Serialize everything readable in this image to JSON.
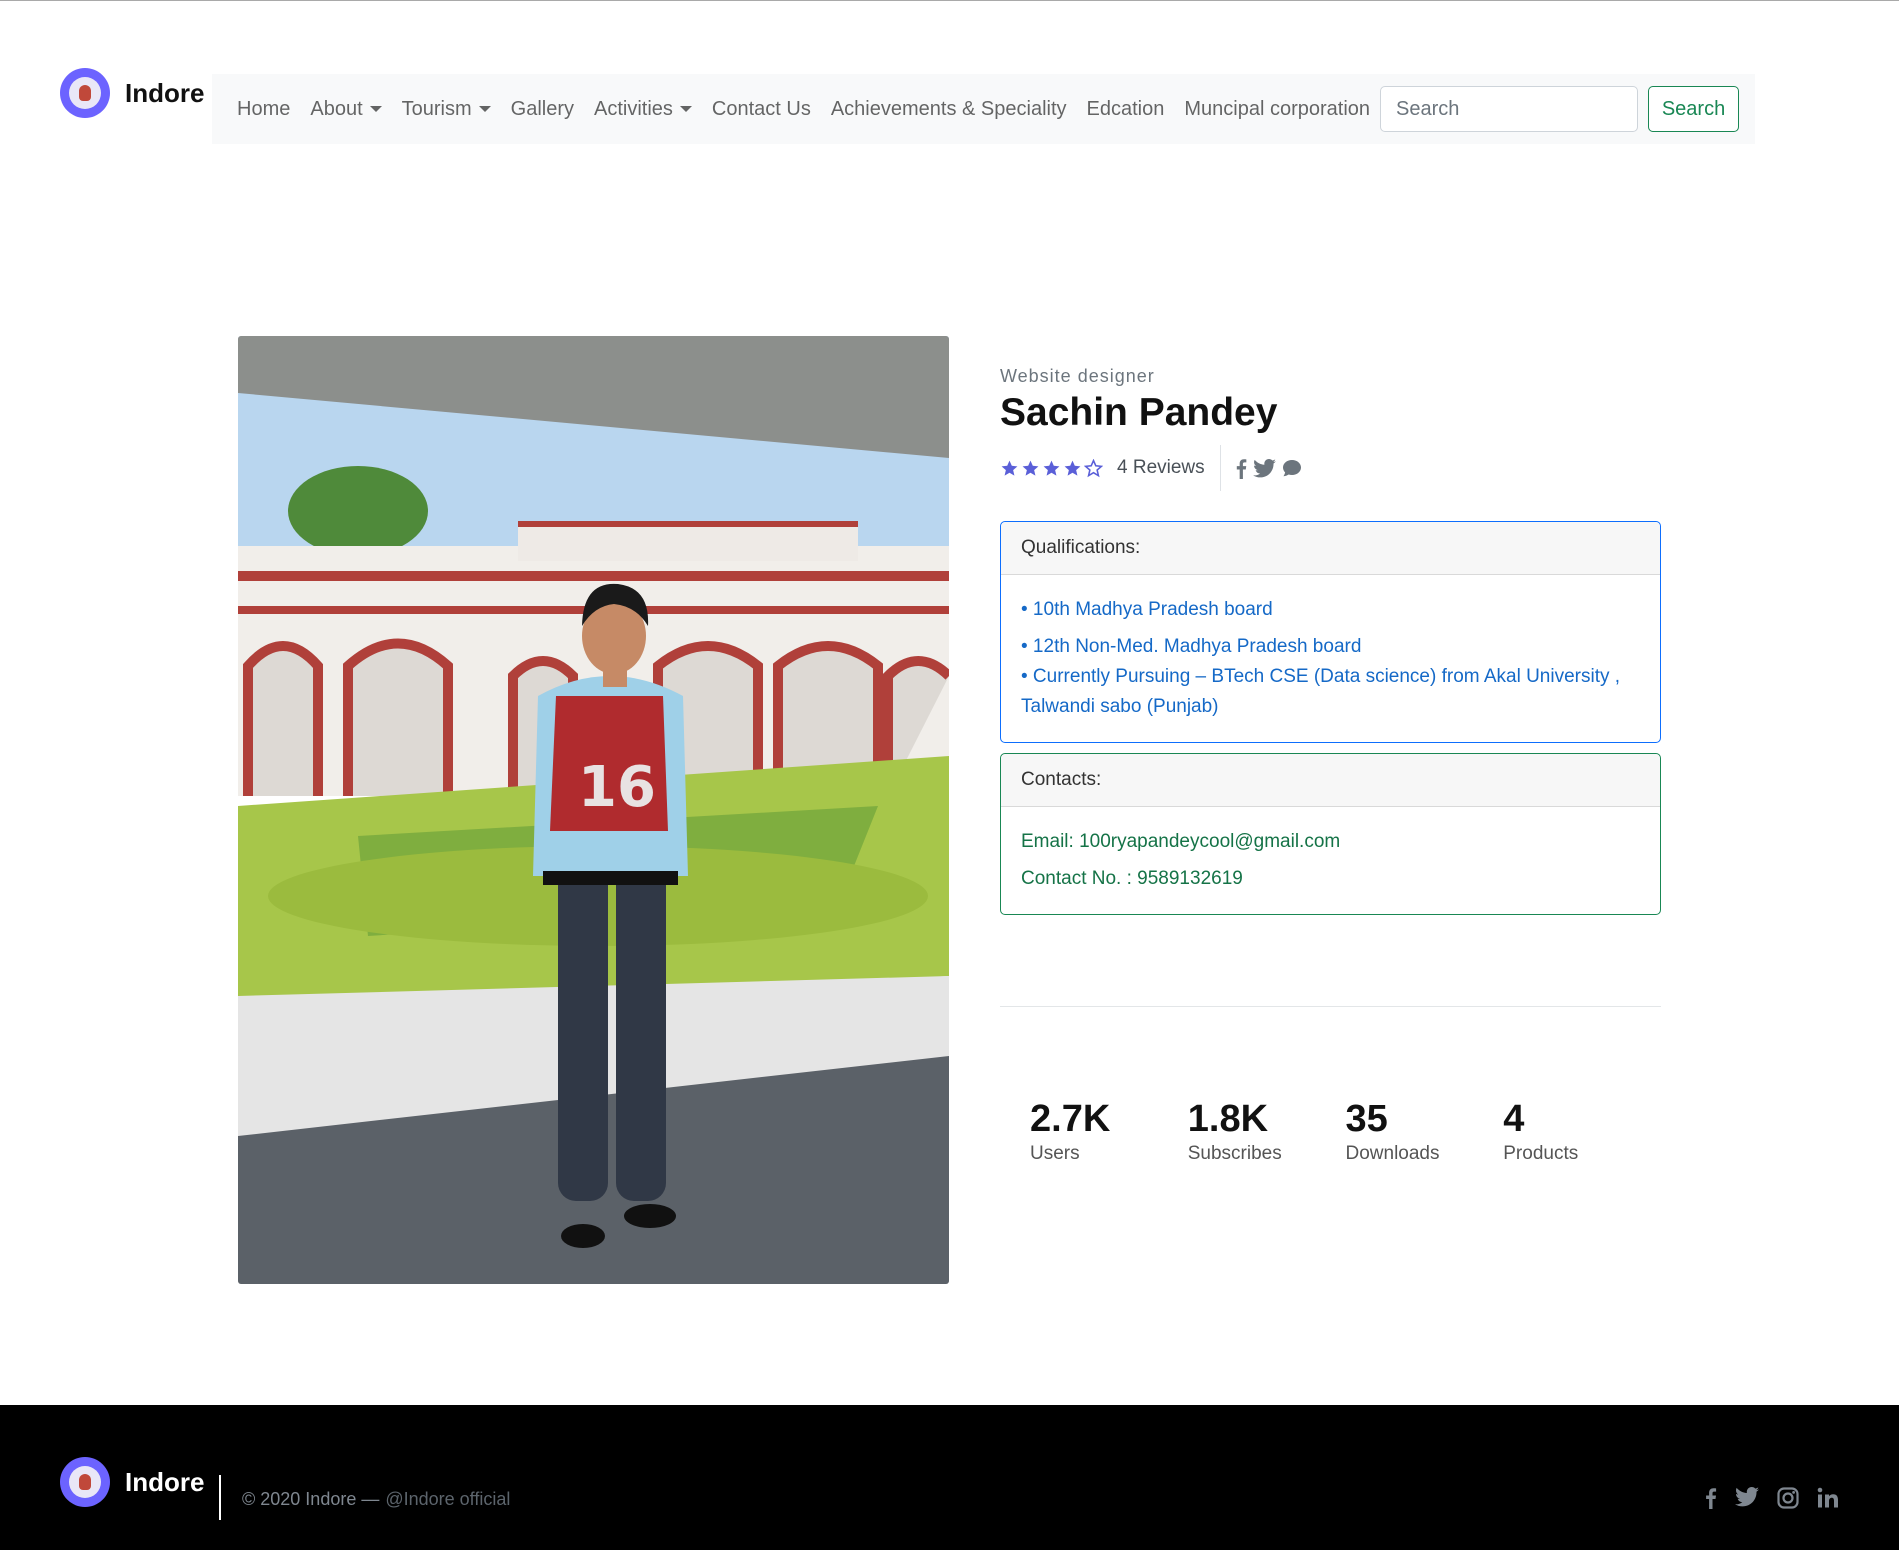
{
  "brand": {
    "name": "Indore"
  },
  "nav": {
    "items": [
      {
        "label": "Home",
        "dropdown": false
      },
      {
        "label": "About",
        "dropdown": true
      },
      {
        "label": "Tourism",
        "dropdown": true
      },
      {
        "label": "Gallery",
        "dropdown": false
      },
      {
        "label": "Activities",
        "dropdown": true
      },
      {
        "label": "Contact Us",
        "dropdown": false
      },
      {
        "label": "Achievements & Speciality",
        "dropdown": false
      },
      {
        "label": "Edcation",
        "dropdown": false
      },
      {
        "label": "Muncipal corporation",
        "dropdown": false
      }
    ],
    "search_placeholder": "Search",
    "search_button": "Search"
  },
  "profile": {
    "role": "Website designer",
    "name": "Sachin Pandey",
    "rating": 4,
    "rating_max": 5,
    "reviews": "4 Reviews",
    "social_icons": [
      "facebook-icon",
      "twitter-icon",
      "chat-icon"
    ]
  },
  "qualifications": {
    "title": "Qualifications:",
    "items": [
      "• 10th Madhya Pradesh board",
      "• 12th Non-Med. Madhya Pradesh board",
      "• Currently Pursuing – BTech CSE (Data science) from Akal University , Talwandi sabo (Punjab)"
    ]
  },
  "contacts": {
    "title": "Contacts:",
    "email": "Email: 100ryapandeycool@gmail.com",
    "phone": "Contact No. : 9589132619"
  },
  "stats": [
    {
      "value": "2.7K",
      "label": "Users"
    },
    {
      "value": "1.8K",
      "label": "Subscribes"
    },
    {
      "value": "35",
      "label": "Downloads"
    },
    {
      "value": "4",
      "label": "Products"
    }
  ],
  "footer": {
    "brand": "Indore",
    "copyright": "© 2020 Indore —",
    "handle": "@Indore official",
    "social_icons": [
      "facebook-icon",
      "twitter-icon",
      "instagram-icon",
      "linkedin-icon"
    ]
  },
  "colors": {
    "accent": "#6c63ff",
    "primary": "#0d6efd",
    "success": "#198754",
    "star": "#5a5fd8",
    "footer_bg": "#000000"
  }
}
